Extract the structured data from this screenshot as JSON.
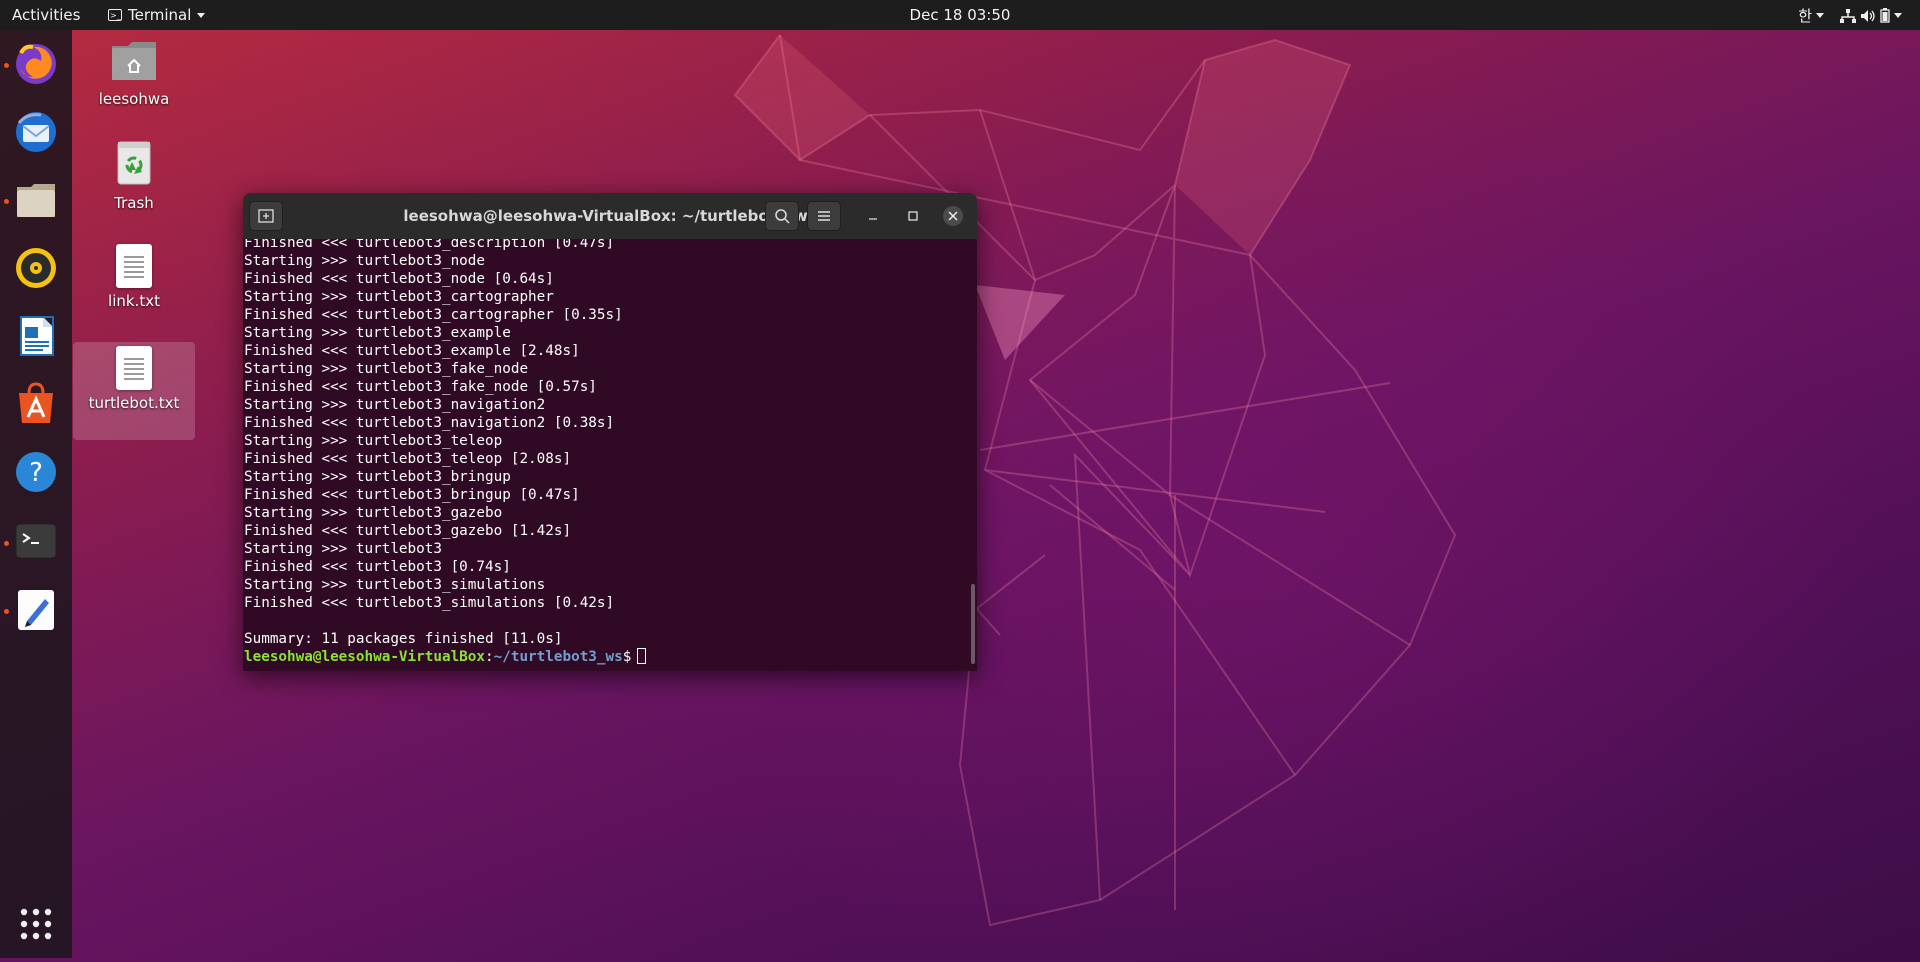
{
  "top_bar": {
    "activities": "Activities",
    "app_menu": "Terminal",
    "clock": "Dec 18  03:50",
    "input_method": "한"
  },
  "dock": {
    "items": [
      {
        "name": "firefox",
        "running": true
      },
      {
        "name": "thunderbird",
        "running": false
      },
      {
        "name": "files",
        "running": true
      },
      {
        "name": "rhythmbox",
        "running": false
      },
      {
        "name": "libreoffice-writer",
        "running": false
      },
      {
        "name": "ubuntu-software",
        "running": false
      },
      {
        "name": "help",
        "running": false
      },
      {
        "name": "terminal",
        "running": true
      },
      {
        "name": "text-editor",
        "running": true
      }
    ],
    "show_apps": "show-applications"
  },
  "desktop_icons": [
    {
      "label": "leesohwa",
      "icon": "home-folder-icon"
    },
    {
      "label": "Trash",
      "icon": "trash-icon"
    },
    {
      "label": "link.txt",
      "icon": "text-file-icon"
    },
    {
      "label": "turtlebot.txt",
      "icon": "text-file-icon",
      "selected": true
    }
  ],
  "terminal": {
    "title": "leesohwa@leesohwa-VirtualBox: ~/turtlebot3_ws",
    "lines": [
      "Finished <<< turtlebot3_description [0.47s]",
      "Starting >>> turtlebot3_node",
      "Finished <<< turtlebot3_node [0.64s]",
      "Starting >>> turtlebot3_cartographer",
      "Finished <<< turtlebot3_cartographer [0.35s]",
      "Starting >>> turtlebot3_example",
      "Finished <<< turtlebot3_example [2.48s]",
      "Starting >>> turtlebot3_fake_node",
      "Finished <<< turtlebot3_fake_node [0.57s]",
      "Starting >>> turtlebot3_navigation2",
      "Finished <<< turtlebot3_navigation2 [0.38s]",
      "Starting >>> turtlebot3_teleop",
      "Finished <<< turtlebot3_teleop [2.08s]",
      "Starting >>> turtlebot3_bringup",
      "Finished <<< turtlebot3_bringup [0.47s]",
      "Starting >>> turtlebot3_gazebo",
      "Finished <<< turtlebot3_gazebo [1.42s]",
      "Starting >>> turtlebot3",
      "Finished <<< turtlebot3 [0.74s]",
      "Starting >>> turtlebot3_simulations",
      "Finished <<< turtlebot3_simulations [0.42s]",
      "",
      "Summary: 11 packages finished [11.0s]"
    ],
    "prompt_user_host": "leesohwa@leesohwa-VirtualBox",
    "prompt_separator": ":",
    "prompt_path": "~/turtlebot3_ws",
    "prompt_symbol": "$"
  },
  "colors": {
    "terminal_bg": "#300a24",
    "prompt_user": "#8ae234",
    "prompt_path": "#729fcf",
    "accent": "#e95420"
  }
}
